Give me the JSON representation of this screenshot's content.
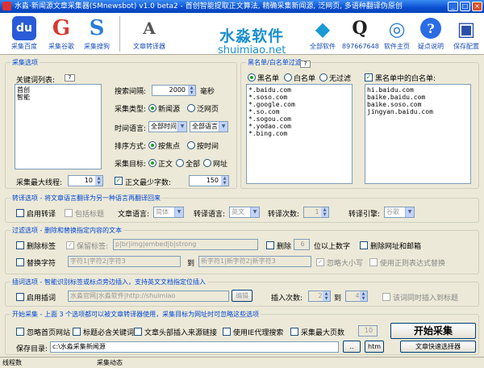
{
  "window": {
    "title": "水淼·新闻源文章采集器(SMnewsbot) v1.0 beta2 - 首创智能提取正文算法, 精确采集新闻源, 泛网页, 多语种翻译伪原创",
    "min": "_",
    "max": "□",
    "close": "×"
  },
  "toolbar": {
    "items": [
      {
        "label": "采集百度",
        "glyph": "du"
      },
      {
        "label": "采集谷歌",
        "glyph": "G"
      },
      {
        "label": "采集搜狗",
        "glyph": "S"
      },
      {
        "label": "文章转译器",
        "glyph": "A"
      },
      {
        "label": "全部软件",
        "glyph": "◆"
      },
      {
        "label": "897667648",
        "glyph": "Q"
      },
      {
        "label": "软件主页",
        "glyph": "◎"
      },
      {
        "label": "疑点说明",
        "glyph": "?"
      },
      {
        "label": "保存配置",
        "glyph": "▣"
      }
    ],
    "brand_cn": "水淼软件",
    "brand_en": "shuimiao.net"
  },
  "collect": {
    "legend": "采集选项",
    "keywords_label": "关键词列表:",
    "help": "?",
    "keywords": "首创\n智能",
    "interval_label": "搜索间隔:",
    "interval": "2000",
    "interval_unit": "毫秒",
    "type_label": "采集类型:",
    "type_news": "新闻源",
    "type_web": "泛网页",
    "time_label": "时间语言:",
    "time_value": "全部时间",
    "lang_value": "全部语言",
    "sort_label": "排序方式:",
    "sort_relevance": "按焦点",
    "sort_time": "按时间",
    "target_label": "采集目标:",
    "target_body": "正文",
    "target_all": "全部",
    "target_url": "网址",
    "threads_label": "采集最大线程:",
    "threads": "10",
    "minwords_label": "正文最少字数:",
    "minwords": "150"
  },
  "filter": {
    "legend": "黑名单/白名单过滤",
    "help": "?",
    "black": "黑名单",
    "white": "白名单",
    "none": "无过滤",
    "black_list": "*.baidu.com\n*.soso.com\n*.google.com\n*.so.com\n*.sogou.com\n*.yodao.com\n*.bing.com",
    "white_check": "黑名单中的白名单:",
    "white_list": "hi.baidu.com\nbaike.baidu.com\nbaike.soso.com\njingyan.baidu.com"
  },
  "translate": {
    "legend": "转译选项 - 将文章语言翻译为另一种语言再翻译回来",
    "enable": "启用转译",
    "title": "包括标题",
    "lang_label": "文章语言:",
    "lang": "简体",
    "to_label": "转译语言:",
    "to": "英文",
    "times_label": "转译次数:",
    "times": "1",
    "engine_label": "转译引擎:",
    "engine": "谷歌"
  },
  "filter2": {
    "legend": "过滤选项 - 删除和替换指定内容的文本",
    "del_tags": "删除标签",
    "keep_tags": "保留标签:",
    "keep_value": "p|br|img|embed|b|strong",
    "del_label": "删除",
    "del_num": "6",
    "del_suffix": "位以上数字",
    "del_url": "删除网址和邮箱",
    "replace": "替换字符",
    "rep_from": "字符1|字符2|字符3",
    "to_label": "到",
    "rep_to": "新字符1|新字符2|新字符3",
    "ignore_case": "忽略大小写",
    "regex": "使用正则表达式替换"
  },
  "insert": {
    "legend": "插词选项 - 智能识别标签或标点旁边插入，支持英文文档指定位插入",
    "enable": "启用插词",
    "words": "水淼官网|水淼软件|http://shuimiao",
    "edit": "编辑",
    "count_label": "插入次数:",
    "from": "2",
    "to_label": "到",
    "to": "4",
    "same": "该词同时插入到标题"
  },
  "start": {
    "legend": "开始采集 - 上面 3 个选项都可以被文章转译器使用，采集目标为网址时可忽略这些选项",
    "ignore_home": "忽略首页网站",
    "must_kw": "标题必含关键词",
    "head_link": "文章头部插入来源链接",
    "ie_proxy": "使用IE代理搜索",
    "max_pages": "采集最大页数",
    "pages": "10",
    "start_btn": "开始采集",
    "dir_label": "保存目录:",
    "dir": "c:\\水淼采集新闻源",
    "browse": "..",
    "htm": "htm",
    "compile": "文章快速选择器"
  },
  "status": {
    "threads": "线程数",
    "state": "采集动态"
  },
  "colors": {
    "title": "#0a4fd0",
    "legend": "#0046d5",
    "brand": "#1a8fd0"
  }
}
